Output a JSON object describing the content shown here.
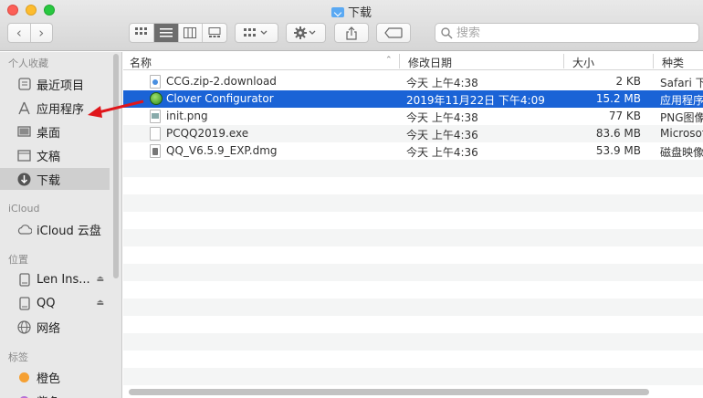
{
  "window": {
    "title": "下载"
  },
  "toolbar": {
    "back_glyph": "‹",
    "forward_glyph": "›",
    "search_placeholder": "搜索"
  },
  "sidebar": {
    "sections": {
      "favorites": "个人收藏",
      "icloud": "iCloud",
      "locations": "位置",
      "tags": "标签"
    },
    "items": [
      {
        "label": "最近项目",
        "icon": "recents-icon"
      },
      {
        "label": "应用程序",
        "icon": "applications-icon"
      },
      {
        "label": "桌面",
        "icon": "desktop-icon"
      },
      {
        "label": "文稿",
        "icon": "documents-icon"
      },
      {
        "label": "下载",
        "icon": "downloads-icon",
        "active": true
      },
      {
        "label": "iCloud 云盘",
        "icon": "cloud-icon"
      },
      {
        "label": "Len Ins...",
        "icon": "disk-icon"
      },
      {
        "label": "QQ",
        "icon": "disk-icon"
      },
      {
        "label": "网络",
        "icon": "network-icon"
      },
      {
        "label": "橙色",
        "icon": "tag-orange-icon",
        "color": "#f5a033"
      },
      {
        "label": "紫色",
        "icon": "tag-purple-icon",
        "color": "#b770d6"
      }
    ]
  },
  "columns": {
    "name": "名称",
    "date": "修改日期",
    "size": "大小",
    "kind": "种类"
  },
  "files": [
    {
      "name": "CCG.zip-2.download",
      "date": "今天 上午4:38",
      "size": "2 KB",
      "kind": "Safari 下载"
    },
    {
      "name": "Clover Configurator",
      "date": "2019年11月22日 下午4:09",
      "size": "15.2 MB",
      "kind": "应用程序"
    },
    {
      "name": "init.png",
      "date": "今天 上午4:38",
      "size": "77 KB",
      "kind": "PNG图像"
    },
    {
      "name": "PCQQ2019.exe",
      "date": "今天 上午4:36",
      "size": "83.6 MB",
      "kind": "Microsoft"
    },
    {
      "name": "QQ_V6.5.9_EXP.dmg",
      "date": "今天 上午4:36",
      "size": "53.9 MB",
      "kind": "磁盘映像"
    }
  ],
  "colors": {
    "selection": "#1a63d6",
    "annotation_arrow": "#e0161b"
  }
}
